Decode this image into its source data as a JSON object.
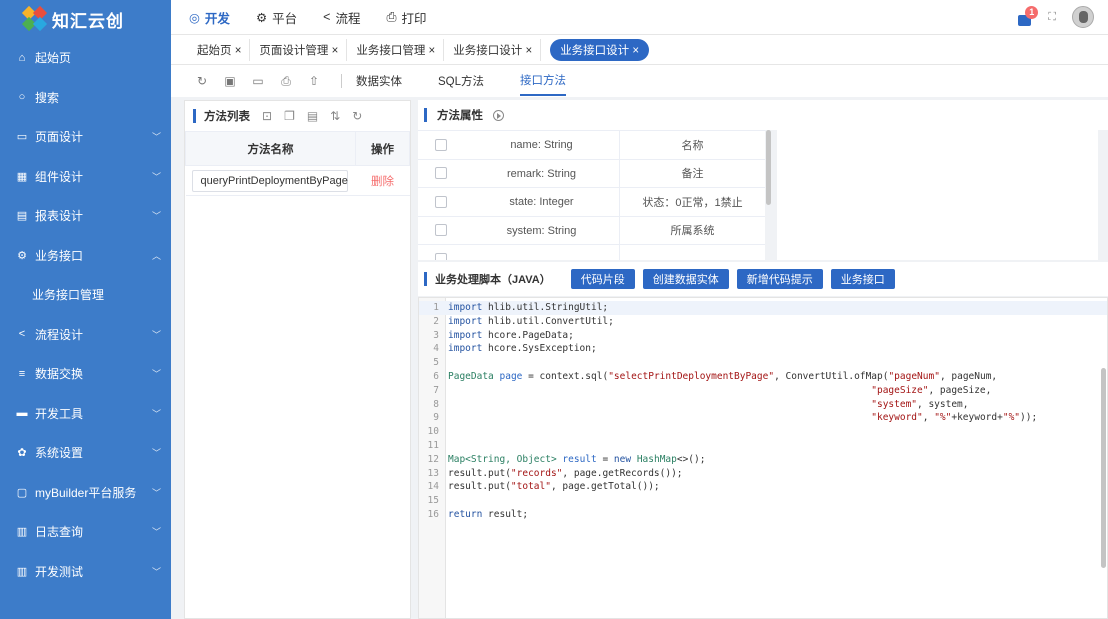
{
  "app": {
    "logo_text": "知汇云创"
  },
  "sidebar": {
    "items": [
      {
        "label": "起始页",
        "icon": "home-icon",
        "chev": ""
      },
      {
        "label": "搜索",
        "icon": "search-icon",
        "chev": ""
      },
      {
        "label": "页面设计",
        "icon": "page-icon",
        "chev": "﹀"
      },
      {
        "label": "组件设计",
        "icon": "grid-icon",
        "chev": "﹀"
      },
      {
        "label": "报表设计",
        "icon": "report-icon",
        "chev": "﹀"
      },
      {
        "label": "业务接口",
        "icon": "gear-icon",
        "chev": "︿"
      },
      {
        "label": "业务接口管理",
        "icon": "",
        "chev": ""
      },
      {
        "label": "流程设计",
        "icon": "share-icon",
        "chev": "﹀"
      },
      {
        "label": "数据交换",
        "icon": "database-icon",
        "chev": "﹀"
      },
      {
        "label": "开发工具",
        "icon": "toolbox-icon",
        "chev": "﹀"
      },
      {
        "label": "系统设置",
        "icon": "settings-icon",
        "chev": "﹀"
      },
      {
        "label": "myBuilder平台服务",
        "icon": "service-icon",
        "chev": "﹀"
      },
      {
        "label": "日志查询",
        "icon": "log-icon",
        "chev": "﹀"
      },
      {
        "label": "开发测试",
        "icon": "test-icon",
        "chev": "﹀"
      }
    ]
  },
  "topnav": {
    "items": [
      {
        "label": "开发",
        "icon": "dev-icon"
      },
      {
        "label": "平台",
        "icon": "platform-icon"
      },
      {
        "label": "流程",
        "icon": "flow-icon"
      },
      {
        "label": "打印",
        "icon": "print-icon"
      }
    ],
    "badge_count": "1"
  },
  "tabs": [
    {
      "label": "起始页 ×"
    },
    {
      "label": "页面设计管理 ×"
    },
    {
      "label": "业务接口管理 ×"
    },
    {
      "label": "业务接口设计 ×"
    },
    {
      "label": "业务接口设计 ×"
    }
  ],
  "toolbar": {
    "subtabs": [
      "数据实体",
      "SQL方法",
      "接口方法"
    ]
  },
  "method_list": {
    "title": "方法列表",
    "col_name": "方法名称",
    "col_action": "操作",
    "rows": [
      {
        "name": "queryPrintDeploymentByPage",
        "action": "删除"
      }
    ]
  },
  "method_props": {
    "title": "方法属性",
    "rows": [
      {
        "name": "name: String",
        "desc": "名称"
      },
      {
        "name": "remark: String",
        "desc": "备注"
      },
      {
        "name": "state: Integer",
        "desc": "状态：0正常，1禁止"
      },
      {
        "name": "system: String",
        "desc": "所属系统"
      },
      {
        "name": "",
        "desc": ""
      }
    ]
  },
  "script": {
    "title": "业务处理脚本（JAVA）",
    "buttons": [
      "代码片段",
      "创建数据实体",
      "新增代码提示",
      "业务接口"
    ]
  },
  "code_lines": [
    "1",
    "2",
    "3",
    "4",
    "5",
    "6",
    "7",
    "8",
    "9",
    "10",
    "11",
    "12",
    "13",
    "14",
    "15",
    "16"
  ],
  "colors": {
    "brand": "#3d7cc9",
    "accent": "#2d68c4",
    "danger": "#f56c6c"
  }
}
